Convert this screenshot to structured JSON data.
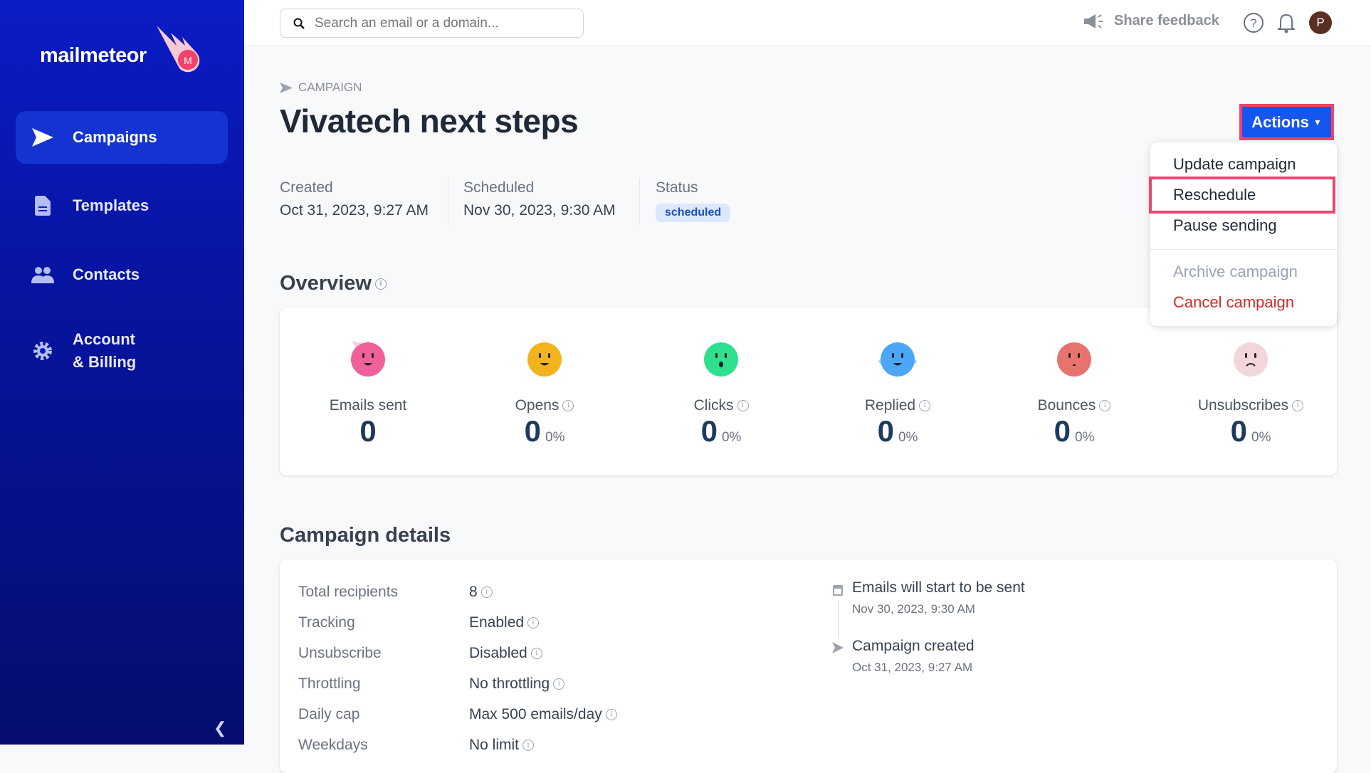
{
  "sidebar": {
    "logo_text": "mailmeteor",
    "items": [
      {
        "label": "Campaigns",
        "icon": "send-icon",
        "active": true
      },
      {
        "label": "Templates",
        "icon": "document-icon"
      },
      {
        "label": "Contacts",
        "icon": "users-icon"
      },
      {
        "label": "Account\n& Billing",
        "line1": "Account",
        "line2": "& Billing",
        "icon": "gear-icon"
      }
    ]
  },
  "header": {
    "search_placeholder": "Search an email or a domain...",
    "feedback_label": "Share feedback",
    "avatar_initial": "P"
  },
  "page": {
    "breadcrumb": "CAMPAIGN",
    "title": "Vivatech next steps",
    "meta": [
      {
        "label": "Created",
        "value": "Oct 31, 2023, 9:27 AM"
      },
      {
        "label": "Scheduled",
        "value": "Nov 30, 2023, 9:30 AM"
      },
      {
        "label": "Status",
        "value": "scheduled"
      }
    ],
    "actions_label": "Actions",
    "actions_menu": [
      "Update campaign",
      "Reschedule",
      "Pause sending",
      "Archive campaign",
      "Cancel campaign"
    ]
  },
  "overview": {
    "title": "Overview",
    "stats": [
      {
        "label": "Emails sent",
        "value": "0",
        "color": "#f0609a"
      },
      {
        "label": "Opens",
        "value": "0",
        "pct": "0%",
        "color": "#f2b31c"
      },
      {
        "label": "Clicks",
        "value": "0",
        "pct": "0%",
        "color": "#2fe08e"
      },
      {
        "label": "Replied",
        "value": "0",
        "pct": "0%",
        "color": "#4ba6f5"
      },
      {
        "label": "Bounces",
        "value": "0",
        "pct": "0%",
        "color": "#e8736e"
      },
      {
        "label": "Unsubscribes",
        "value": "0",
        "pct": "0%",
        "color": "#f3d6dc"
      }
    ]
  },
  "details": {
    "title": "Campaign details",
    "rows": [
      {
        "label": "Total recipients",
        "value": "8"
      },
      {
        "label": "Tracking",
        "value": "Enabled"
      },
      {
        "label": "Unsubscribe",
        "value": "Disabled"
      },
      {
        "label": "Throttling",
        "value": "No throttling"
      },
      {
        "label": "Daily cap",
        "value": "Max 500 emails/day"
      },
      {
        "label": "Weekdays",
        "value": "No limit"
      }
    ],
    "timeline": [
      {
        "title": "Emails will start to be sent",
        "date": "Nov 30, 2023, 9:30 AM",
        "icon": "calendar-icon"
      },
      {
        "title": "Campaign created",
        "date": "Oct 31, 2023, 9:27 AM",
        "icon": "send-icon"
      }
    ]
  },
  "colors": {
    "sidebar": "#0a1cc4",
    "accent": "#1556ef",
    "highlight": "#f0436c",
    "danger": "#d42a2a"
  }
}
